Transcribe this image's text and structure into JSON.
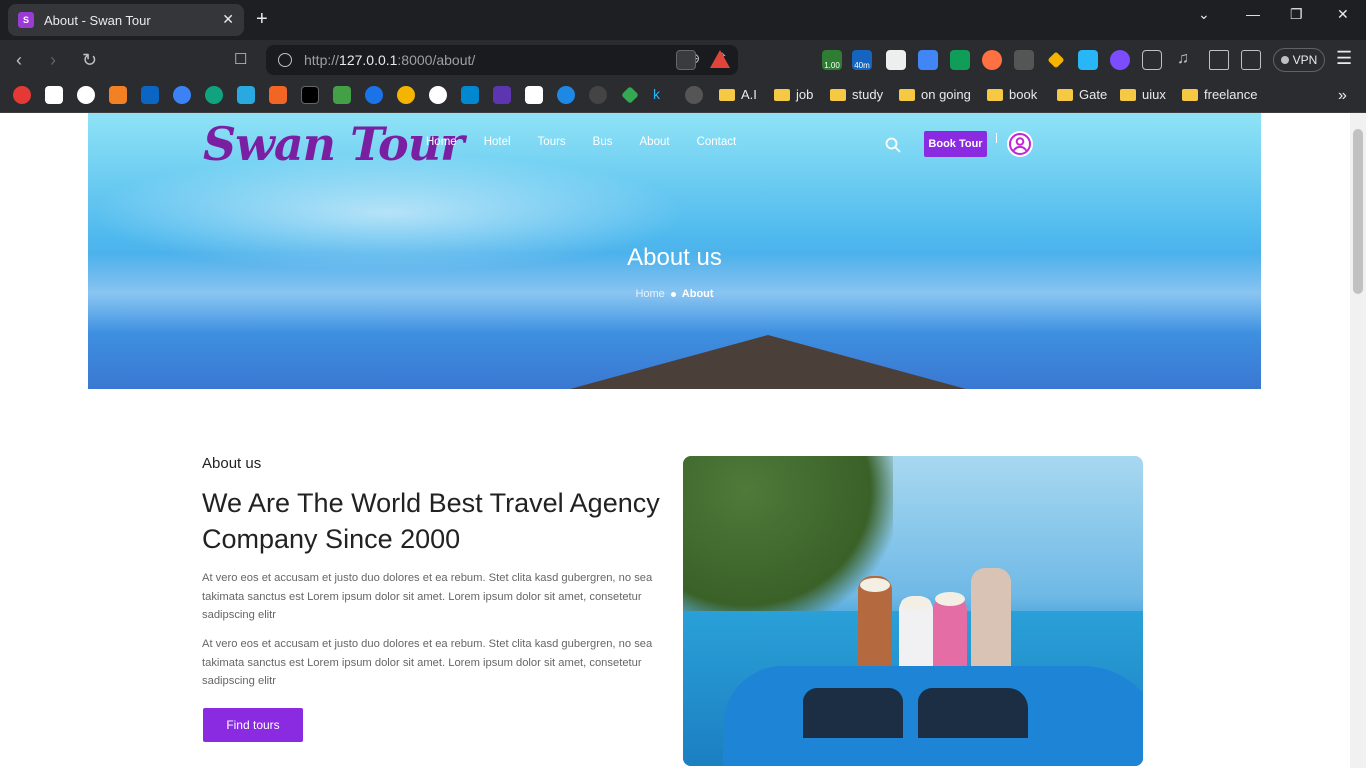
{
  "browser": {
    "tab_title": "About - Swan Tour",
    "url_prefix": "http://",
    "url_host": "127.0.0.1",
    "url_rest": ":8000/about/",
    "vpn_label": "VPN",
    "ext_badges": [
      "1.00",
      "40m"
    ],
    "bookmark_folders": [
      "A.I",
      "job",
      "study",
      "on going",
      "book",
      "Gate",
      "uiux",
      "freelance"
    ]
  },
  "site": {
    "logo": "Swan Tour",
    "nav": [
      "Home",
      "Hotel",
      "Tours",
      "Bus",
      "About",
      "Contact"
    ],
    "book_button": "Book Tour",
    "hero_title": "About us",
    "breadcrumb_home": "Home",
    "breadcrumb_current": "About"
  },
  "about": {
    "subtitle": "About us",
    "headline": "We Are The World Best Travel Agency Company Since 2000",
    "paragraph1": "At vero eos et accusam et justo duo dolores et ea rebum. Stet clita kasd gubergren, no sea takimata sanctus est Lorem ipsum dolor sit amet. Lorem ipsum dolor sit amet, consetetur sadipscing elitr",
    "paragraph2": "At vero eos et accusam et justo duo dolores et ea rebum. Stet clita kasd gubergren, no sea takimata sanctus est Lorem ipsum dolor sit amet. Lorem ipsum dolor sit amet, consetetur sadipscing elitr",
    "cta": "Find tours"
  },
  "colors": {
    "brand_purple": "#8a2be2",
    "logo_purple": "#7b1fa2"
  }
}
